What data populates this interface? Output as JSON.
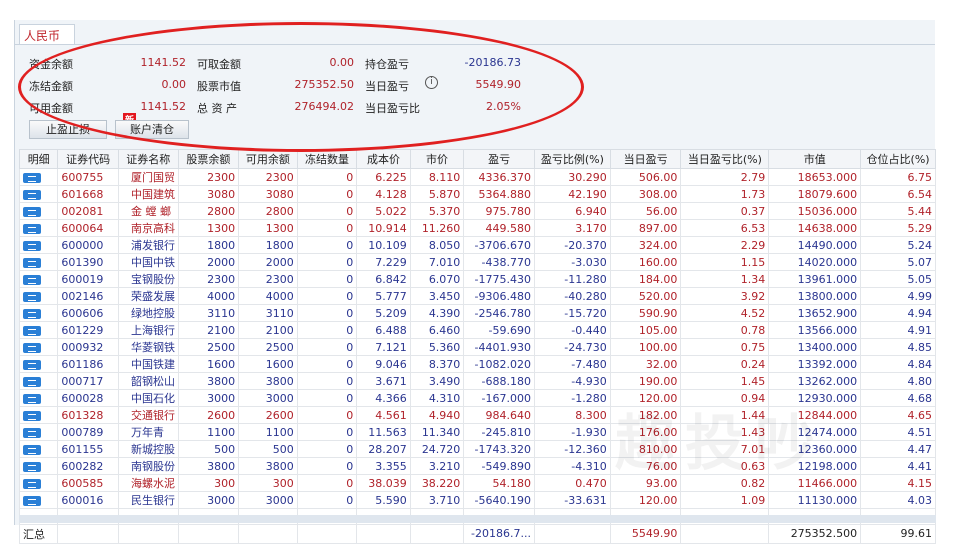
{
  "tab": "人民币",
  "summary": {
    "c1": [
      {
        "label": "资金余额",
        "value": "1141.52"
      },
      {
        "label": "冻结金额",
        "value": "0.00"
      },
      {
        "label": "可用金额",
        "value": "1141.52"
      }
    ],
    "c2": [
      {
        "label": "可取金额",
        "value": "0.00"
      },
      {
        "label": "股票市值",
        "value": "275352.50"
      },
      {
        "label": "总 资 产",
        "value": "276494.02"
      }
    ],
    "c3": [
      {
        "label": "持仓盈亏",
        "value": "-20186.73"
      },
      {
        "label": "当日盈亏",
        "value": "5549.90"
      },
      {
        "label": "当日盈亏比",
        "value": "2.05%"
      }
    ],
    "info_icon": "i"
  },
  "buttons": {
    "stop": "止盈止损",
    "badge": "新",
    "clear": "账户清仓"
  },
  "columns": [
    "明细",
    "证券代码",
    "证券名称",
    "股票余额",
    "可用余额",
    "冻结数量",
    "成本价",
    "市价",
    "盈亏",
    "盈亏比例(%)",
    "当日盈亏",
    "当日盈亏比(%)",
    "市值",
    "仓位占比(%)"
  ],
  "colors": {
    "up": "#b0222a",
    "down": "#2a3590"
  },
  "rows": [
    [
      "600755",
      "厦门国贸",
      "2300",
      "2300",
      "0",
      "6.225",
      "8.110",
      "4336.370",
      "30.290",
      "506.00",
      "2.79",
      "18653.000",
      "6.75",
      "up"
    ],
    [
      "601668",
      "中国建筑",
      "3080",
      "3080",
      "0",
      "4.128",
      "5.870",
      "5364.880",
      "42.190",
      "308.00",
      "1.73",
      "18079.600",
      "6.54",
      "up"
    ],
    [
      "002081",
      "金 螳 螂",
      "2800",
      "2800",
      "0",
      "5.022",
      "5.370",
      "975.780",
      "6.940",
      "56.00",
      "0.37",
      "15036.000",
      "5.44",
      "up"
    ],
    [
      "600064",
      "南京高科",
      "1300",
      "1300",
      "0",
      "10.914",
      "11.260",
      "449.580",
      "3.170",
      "897.00",
      "6.53",
      "14638.000",
      "5.29",
      "up"
    ],
    [
      "600000",
      "浦发银行",
      "1800",
      "1800",
      "0",
      "10.109",
      "8.050",
      "-3706.670",
      "-20.370",
      "324.00",
      "2.29",
      "14490.000",
      "5.24",
      "down"
    ],
    [
      "601390",
      "中国中铁",
      "2000",
      "2000",
      "0",
      "7.229",
      "7.010",
      "-438.770",
      "-3.030",
      "160.00",
      "1.15",
      "14020.000",
      "5.07",
      "down"
    ],
    [
      "600019",
      "宝钢股份",
      "2300",
      "2300",
      "0",
      "6.842",
      "6.070",
      "-1775.430",
      "-11.280",
      "184.00",
      "1.34",
      "13961.000",
      "5.05",
      "down"
    ],
    [
      "002146",
      "荣盛发展",
      "4000",
      "4000",
      "0",
      "5.777",
      "3.450",
      "-9306.480",
      "-40.280",
      "520.00",
      "3.92",
      "13800.000",
      "4.99",
      "down"
    ],
    [
      "600606",
      "绿地控股",
      "3110",
      "3110",
      "0",
      "5.209",
      "4.390",
      "-2546.780",
      "-15.720",
      "590.90",
      "4.52",
      "13652.900",
      "4.94",
      "down"
    ],
    [
      "601229",
      "上海银行",
      "2100",
      "2100",
      "0",
      "6.488",
      "6.460",
      "-59.690",
      "-0.440",
      "105.00",
      "0.78",
      "13566.000",
      "4.91",
      "down"
    ],
    [
      "000932",
      "华菱钢铁",
      "2500",
      "2500",
      "0",
      "7.121",
      "5.360",
      "-4401.930",
      "-24.730",
      "100.00",
      "0.75",
      "13400.000",
      "4.85",
      "down"
    ],
    [
      "601186",
      "中国铁建",
      "1600",
      "1600",
      "0",
      "9.046",
      "8.370",
      "-1082.020",
      "-7.480",
      "32.00",
      "0.24",
      "13392.000",
      "4.84",
      "down"
    ],
    [
      "000717",
      "韶钢松山",
      "3800",
      "3800",
      "0",
      "3.671",
      "3.490",
      "-688.180",
      "-4.930",
      "190.00",
      "1.45",
      "13262.000",
      "4.80",
      "down"
    ],
    [
      "600028",
      "中国石化",
      "3000",
      "3000",
      "0",
      "4.366",
      "4.310",
      "-167.000",
      "-1.280",
      "120.00",
      "0.94",
      "12930.000",
      "4.68",
      "down"
    ],
    [
      "601328",
      "交通银行",
      "2600",
      "2600",
      "0",
      "4.561",
      "4.940",
      "984.640",
      "8.300",
      "182.00",
      "1.44",
      "12844.000",
      "4.65",
      "up"
    ],
    [
      "000789",
      "万年青",
      "1100",
      "1100",
      "0",
      "11.563",
      "11.340",
      "-245.810",
      "-1.930",
      "176.00",
      "1.43",
      "12474.000",
      "4.51",
      "down"
    ],
    [
      "601155",
      "新城控股",
      "500",
      "500",
      "0",
      "28.207",
      "24.720",
      "-1743.320",
      "-12.360",
      "810.00",
      "7.01",
      "12360.000",
      "4.47",
      "down"
    ],
    [
      "600282",
      "南钢股份",
      "3800",
      "3800",
      "0",
      "3.355",
      "3.210",
      "-549.890",
      "-4.310",
      "76.00",
      "0.63",
      "12198.000",
      "4.41",
      "down"
    ],
    [
      "600585",
      "海螺水泥",
      "300",
      "300",
      "0",
      "38.039",
      "38.220",
      "54.180",
      "0.470",
      "93.00",
      "0.82",
      "11466.000",
      "4.15",
      "up"
    ],
    [
      "600016",
      "民生银行",
      "3000",
      "3000",
      "0",
      "5.590",
      "3.710",
      "-5640.190",
      "-33.631",
      "120.00",
      "1.09",
      "11130.000",
      "4.03",
      "down"
    ]
  ],
  "total": {
    "label": "汇总",
    "pnl": "-20186.7...",
    "day_pnl": "5549.90",
    "mv": "275352.500",
    "pos": "99.61"
  }
}
